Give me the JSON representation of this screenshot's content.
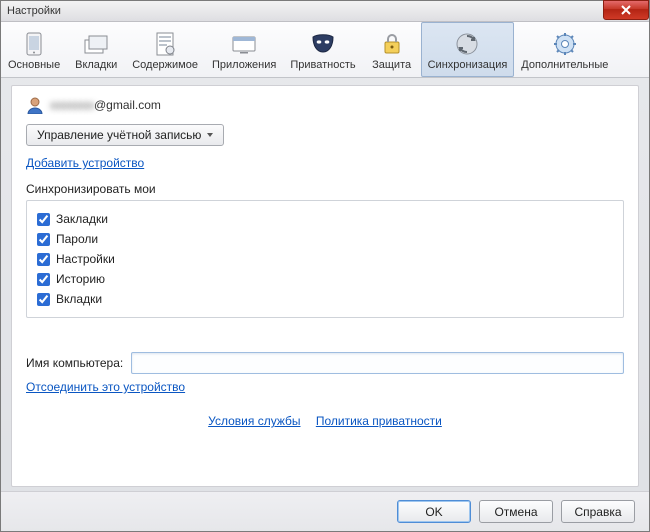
{
  "titlebar": {
    "title": "Настройки"
  },
  "toolbar": {
    "items": [
      {
        "label": "Основные"
      },
      {
        "label": "Вкладки"
      },
      {
        "label": "Содержимое"
      },
      {
        "label": "Приложения"
      },
      {
        "label": "Приватность"
      },
      {
        "label": "Защита"
      },
      {
        "label": "Синхронизация"
      },
      {
        "label": "Дополнительные"
      }
    ],
    "active_index": 6
  },
  "account": {
    "email_blurred_prefix": "xxxxxxxx",
    "email_suffix": "@gmail.com",
    "manage_button": "Управление учётной записью",
    "add_device_link": "Добавить устройство"
  },
  "sync": {
    "heading": "Синхронизировать мои",
    "items": [
      {
        "label": "Закладки",
        "checked": true
      },
      {
        "label": "Пароли",
        "checked": true
      },
      {
        "label": "Настройки",
        "checked": true
      },
      {
        "label": "Историю",
        "checked": true
      },
      {
        "label": "Вкладки",
        "checked": true
      }
    ]
  },
  "computer_name": {
    "label": "Имя компьютера:",
    "value": ""
  },
  "disconnect_link": "Отсоединить это устройство",
  "policy": {
    "terms": "Условия службы",
    "privacy": "Политика приватности"
  },
  "footer": {
    "ok": "OK",
    "cancel": "Отмена",
    "help": "Справка"
  }
}
